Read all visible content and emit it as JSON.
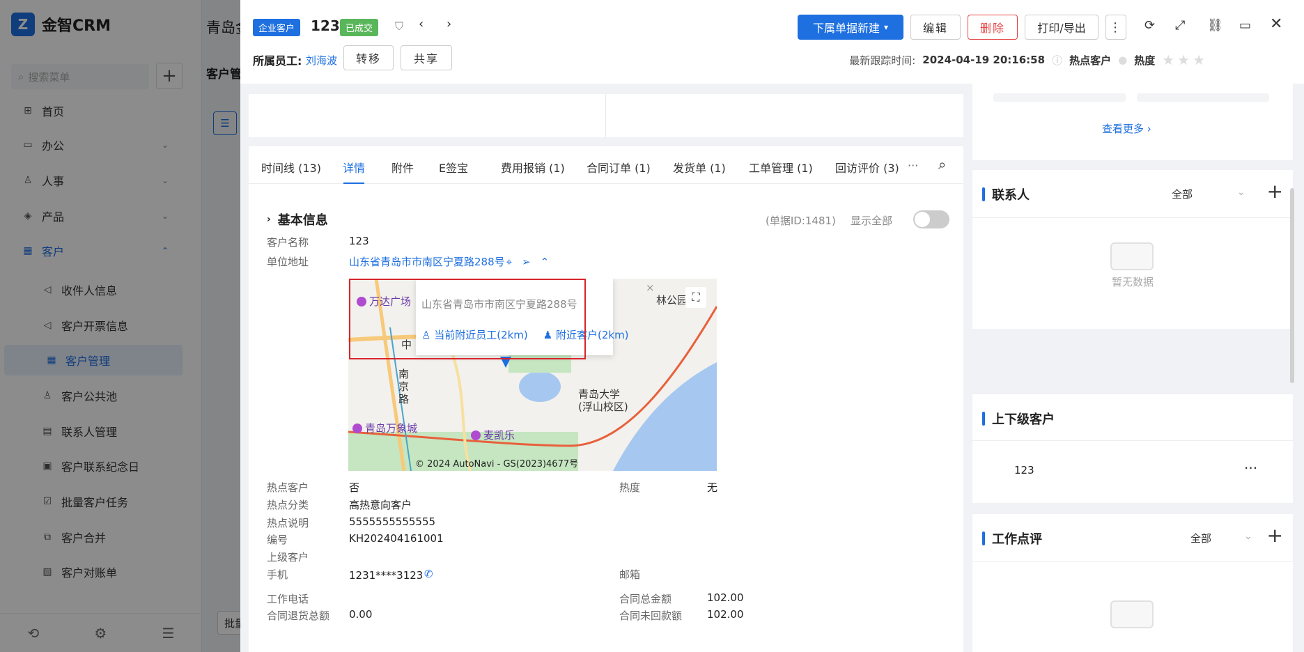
{
  "app": {
    "logo_letter": "Z",
    "name": "金智CRM"
  },
  "sidebar": {
    "search_placeholder": "搜索菜单",
    "add_label": "+",
    "items": [
      {
        "label": "首页",
        "icon": "home-icon",
        "glyph": "⊞"
      },
      {
        "label": "办公",
        "icon": "office-icon",
        "glyph": "▭",
        "caret": "⌄"
      },
      {
        "label": "人事",
        "icon": "people-icon",
        "glyph": "♙",
        "caret": "⌄"
      },
      {
        "label": "产品",
        "icon": "product-icon",
        "glyph": "◈",
        "caret": "⌄"
      },
      {
        "label": "客户",
        "icon": "chart-icon",
        "glyph": "▦",
        "caret": "⌃"
      }
    ],
    "sub_items": [
      {
        "label": "收件人信息",
        "glyph": "◁"
      },
      {
        "label": "客户开票信息",
        "glyph": "◁"
      },
      {
        "label": "客户管理",
        "glyph": "▦"
      },
      {
        "label": "客户公共池",
        "glyph": "♙"
      },
      {
        "label": "联系人管理",
        "glyph": "▤"
      },
      {
        "label": "客户联系纪念日",
        "glyph": "▣"
      },
      {
        "label": "批量客户任务",
        "glyph": "☑"
      },
      {
        "label": "客户合并",
        "glyph": "⧉"
      },
      {
        "label": "客户对账单",
        "glyph": "▨"
      }
    ],
    "footer": {
      "history": "⟲",
      "settings": "⚙",
      "collapse": "☰"
    }
  },
  "background": {
    "title": "青岛金",
    "tab": "客户管",
    "batch_button": "批量"
  },
  "drawer": {
    "header": {
      "tag_type": "企业客户",
      "title": "123",
      "tag_status": "已成交",
      "owner_label": "所属员工:",
      "owner_name": "刘海波",
      "transfer_label": "转移",
      "share_label": "共享",
      "new_sub_label": "下属单据新建",
      "edit_label": "编辑",
      "delete_label": "删除",
      "print_label": "打印/导出",
      "last_follow_label": "最新跟踪时间:",
      "last_follow_time": "2024-04-19 20:16:58",
      "hot_customer_label": "热点客户",
      "heat_label": "热度",
      "stars": "★★★"
    },
    "tabs": [
      {
        "label": "时间线 (13)"
      },
      {
        "label": "详情"
      },
      {
        "label": "附件"
      },
      {
        "label": "E签宝"
      },
      {
        "label": "费用报销 (1)"
      },
      {
        "label": "合同订单 (1)"
      },
      {
        "label": "发货单 (1)"
      },
      {
        "label": "工单管理 (1)"
      },
      {
        "label": "回访评价 (3)"
      }
    ],
    "tabs_more": "···",
    "section": {
      "title": "基本信息",
      "doc_id": "(单据ID:1481)",
      "show_all": "显示全部"
    },
    "fields": {
      "name_label": "客户名称",
      "name_value": "123",
      "address_label": "单位地址",
      "address_value": "山东省青岛市市南区宁夏路288号",
      "hot_label": "热点客户",
      "hot_value": "否",
      "heat_label": "热度",
      "heat_value": "无",
      "hot_cat_label": "热点分类",
      "hot_cat_value": "高热意向客户",
      "hot_desc_label": "热点说明",
      "hot_desc_value": "5555555555555",
      "code_label": "编号",
      "code_value": "KH202404161001",
      "parent_label": "上级客户",
      "parent_value": "",
      "mobile_label": "手机",
      "mobile_value": "1231****3123",
      "email_label": "邮箱",
      "email_value": "",
      "work_phone_label": "工作电话",
      "work_phone_value": "",
      "contract_total_label": "合同总金额",
      "contract_total_value": "102.00",
      "refund_label": "合同退货总额",
      "refund_value": "0.00",
      "unpaid_label": "合同未回款额",
      "unpaid_value": "102.00"
    },
    "map": {
      "copyright": "© 2024 AutoNavi - GS(2023)4677号",
      "popup_address": "山东省青岛市市南区宁夏路288号",
      "popup_nearby_staff": "当前附近员工(2km)",
      "popup_nearby_customers": "附近客户(2km)",
      "pois": {
        "wanda": "万达广场",
        "mixc": "青岛万象城",
        "mykl": "麦凯乐",
        "qdu": "青岛大学",
        "qdu_sub": "(浮山校区)",
        "road": "南京路",
        "zhong": "中",
        "park": "林公园"
      }
    },
    "right": {
      "see_more": "查看更多",
      "contacts_title": "联系人",
      "contacts_filter": "全部",
      "empty_text": "暂无数据",
      "parent_child_title": "上下级客户",
      "parent_child_item": "123",
      "review_title": "工作点评",
      "review_filter": "全部"
    }
  },
  "colors": {
    "primary": "#1e6fe0",
    "danger": "#e54545",
    "success": "#5ab65a",
    "highlight_border": "#d9242a"
  }
}
